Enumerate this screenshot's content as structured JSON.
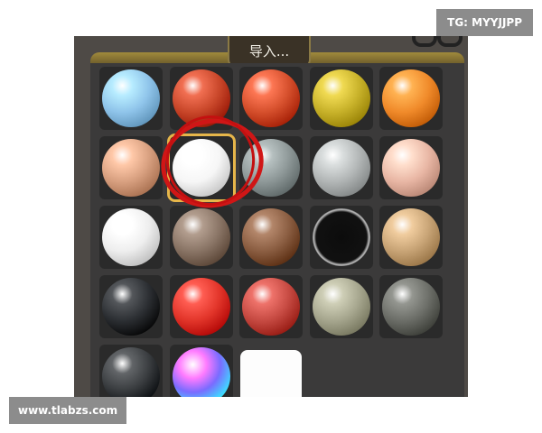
{
  "header": {
    "import_label": "导入..."
  },
  "watermarks": {
    "top_right": "TG: MYYJJPP",
    "bottom_left": "www.tlabzs.com"
  },
  "materials": [
    {
      "name": "matcap-sky-blue",
      "color": "#8fc4ea"
    },
    {
      "name": "matcap-red-clay",
      "color": "#c9472a"
    },
    {
      "name": "matcap-orange-red",
      "color": "#d54f2c"
    },
    {
      "name": "matcap-gold-black",
      "color": "#c8b22a"
    },
    {
      "name": "matcap-orange",
      "color": "#f08a2a"
    },
    {
      "name": "matcap-skin-dark",
      "color": "#d8a080"
    },
    {
      "name": "matcap-white",
      "color": "#f6f6f6",
      "selected": true
    },
    {
      "name": "matcap-gray-green",
      "color": "#8e9898"
    },
    {
      "name": "matcap-silver",
      "color": "#b2b6b6"
    },
    {
      "name": "matcap-skin-pink",
      "color": "#e8b6a4"
    },
    {
      "name": "matcap-white-soft",
      "color": "#eeeeee"
    },
    {
      "name": "matcap-brown-gray",
      "color": "#8a7566"
    },
    {
      "name": "matcap-brown",
      "color": "#8b5e42"
    },
    {
      "name": "matcap-black-rim",
      "color": "#1d1d1d"
    },
    {
      "name": "matcap-tan",
      "color": "#c8a476"
    },
    {
      "name": "matcap-black-gloss",
      "color": "#2c2f33"
    },
    {
      "name": "matcap-red-gloss",
      "color": "#e2352a"
    },
    {
      "name": "matcap-red-matte",
      "color": "#c64a42"
    },
    {
      "name": "matcap-olive-gray",
      "color": "#a6a68e"
    },
    {
      "name": "matcap-dark-gray",
      "color": "#6c6e68"
    },
    {
      "name": "matcap-black-dark",
      "color": "#3a3d40"
    },
    {
      "name": "matcap-rainbow",
      "color": "#ff5aff"
    },
    {
      "name": "matcap-white-tile",
      "color": "#ffffff"
    }
  ],
  "colors": {
    "panel": "#4e4a46",
    "rim": "#a08a3c",
    "selection": "#e6b64a",
    "annotation": "#d01616"
  }
}
